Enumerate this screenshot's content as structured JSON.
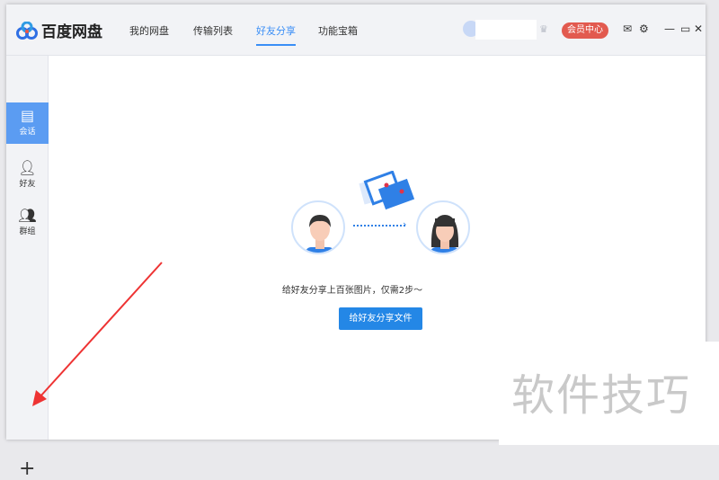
{
  "app": {
    "title": "百度网盘"
  },
  "nav": {
    "tabs": [
      {
        "label": "我的网盘"
      },
      {
        "label": "传输列表"
      },
      {
        "label": "好友分享"
      },
      {
        "label": "功能宝箱"
      }
    ]
  },
  "header": {
    "vip_label": "会员中心"
  },
  "sidebar": {
    "items": [
      {
        "label": "会话"
      },
      {
        "label": "好友"
      },
      {
        "label": "群组"
      }
    ]
  },
  "main": {
    "message": "给好友分享上百张图片，仅需2步～",
    "button_label": "给好友分享文件"
  },
  "watermark": "软件技巧",
  "colors": {
    "accent": "#3a8ef6",
    "vip": "#e25a4f",
    "button": "#2487e6"
  }
}
